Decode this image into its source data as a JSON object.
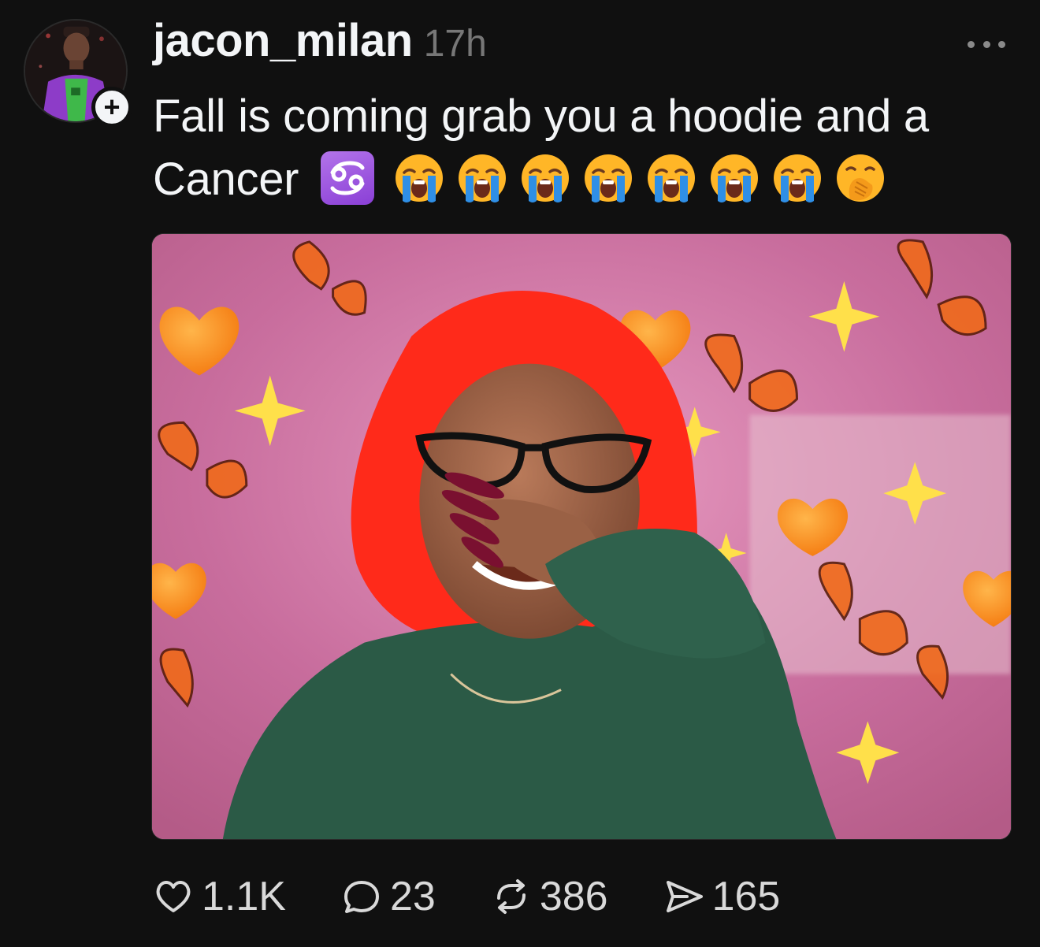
{
  "post": {
    "username": "jacon_milan",
    "time": "17h",
    "caption_text": "Fall is coming grab you a hoodie and a Cancer",
    "emojis": [
      "cancer-zodiac",
      "loudly-crying-face",
      "loudly-crying-face",
      "loudly-crying-face",
      "loudly-crying-face",
      "loudly-crying-face",
      "loudly-crying-face",
      "loudly-crying-face",
      "face-with-hand-over-mouth"
    ],
    "follow_badge": "+",
    "media_alt": "",
    "actions": {
      "likes": "1.1K",
      "replies": "23",
      "reposts": "386",
      "shares": "165"
    }
  },
  "colors": {
    "background": "#101010",
    "text_primary": "#f3f5f7",
    "text_secondary": "#777777",
    "zodiac_purple": "#8a3fd6"
  },
  "icons": {
    "like": "heart-icon",
    "reply": "comment-icon",
    "repost": "repost-icon",
    "share": "send-icon",
    "more": "ellipsis-icon"
  }
}
